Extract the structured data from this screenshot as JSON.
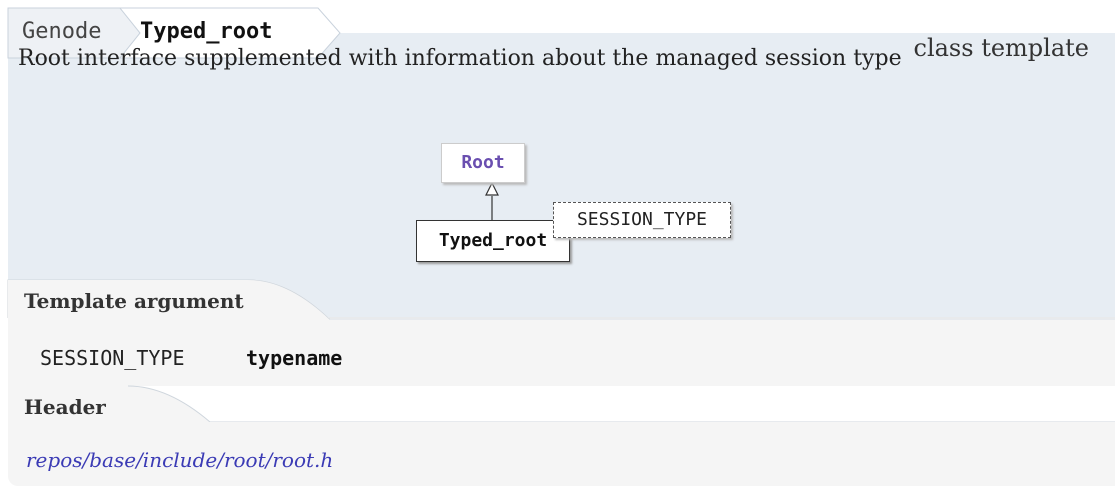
{
  "breadcrumb": {
    "items": [
      "Genode",
      "Typed_root"
    ]
  },
  "class": {
    "description": "Root interface supplemented with information about the managed session type",
    "kind": "class template"
  },
  "diagram": {
    "base_class": "Root",
    "class_name": "Typed_root",
    "template_param": "SESSION_TYPE"
  },
  "template_argument": {
    "title": "Template argument",
    "name": "SESSION_TYPE",
    "type": "typename"
  },
  "header": {
    "title": "Header",
    "path": "repos/base/include/root/root.h"
  },
  "colors": {
    "panel_bg": "#e7edf3",
    "section_bg": "#f5f5f5",
    "link": "#3b3bb5",
    "base_class": "#6a4fb0"
  }
}
